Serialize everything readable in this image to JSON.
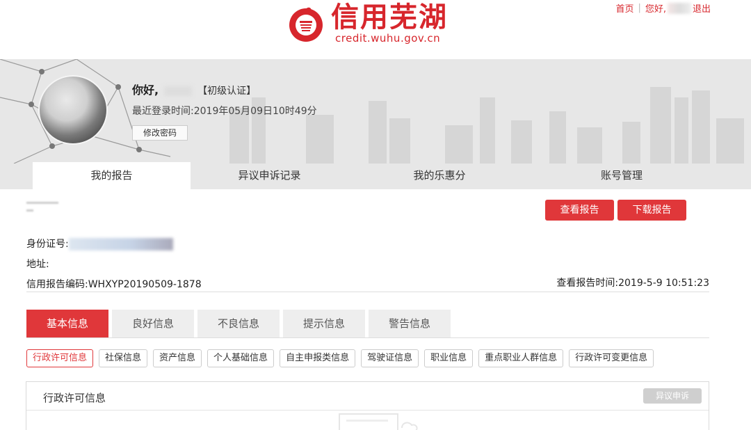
{
  "logo": {
    "title": "信用芜湖",
    "url": "credit.wuhu.gov.cn"
  },
  "top_links": {
    "home": "首页",
    "hello": "您好,",
    "logout": "退出"
  },
  "user": {
    "greeting": "你好,",
    "level": "【初级认证】",
    "last_login": "最近登录时间:2019年05月09日10时49分",
    "change_password": "修改密码"
  },
  "main_tabs": [
    "我的报告",
    "异议申诉记录",
    "我的乐惠分",
    "账号管理"
  ],
  "report": {
    "view_button": "查看报告",
    "download_button": "下载报告",
    "id_label": "身份证号:",
    "address_label": "地址:",
    "code_label": "信用报告编码:WHXYP20190509-1878",
    "view_time": "查看报告时间:2019-5-9 10:51:23"
  },
  "sub_tabs": [
    "基本信息",
    "良好信息",
    "不良信息",
    "提示信息",
    "警告信息"
  ],
  "chips": [
    "行政许可信息",
    "社保信息",
    "资产信息",
    "个人基础信息",
    "自主申报类信息",
    "驾驶证信息",
    "职业信息",
    "重点职业人群信息",
    "行政许可变更信息"
  ],
  "panel": {
    "title": "行政许可信息",
    "dispute": "异议申诉"
  },
  "colors": {
    "brand_red": "#d7262c",
    "button_red": "#e0373a"
  }
}
